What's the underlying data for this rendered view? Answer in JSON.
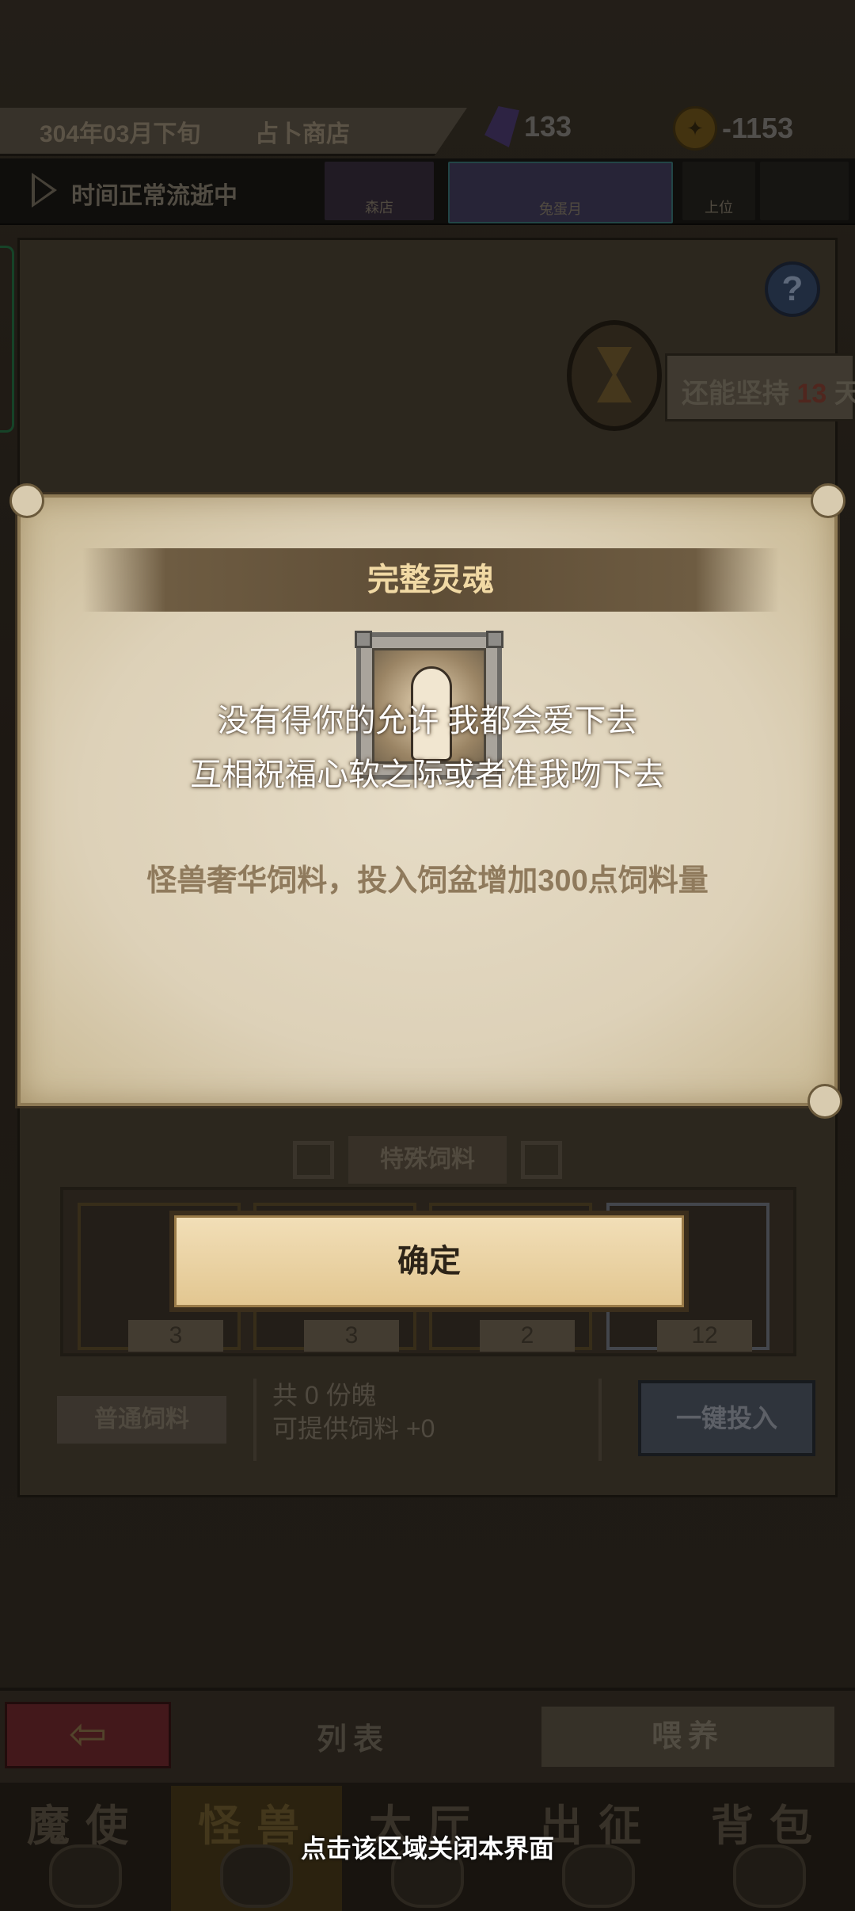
{
  "header": {
    "date": "304年03月下旬",
    "location": "占卜商店",
    "crystal_count": "133",
    "coin_count": "-1153"
  },
  "timebar": {
    "status": "时间正常流逝中",
    "banners": [
      "森店",
      "兔蛋月",
      "上位",
      ""
    ]
  },
  "persist": {
    "prefix": "还能坚持",
    "days": "13",
    "suffix": "天"
  },
  "feed_panel": {
    "special_tab": "特殊饲料",
    "slots": [
      "3",
      "3",
      "2",
      "12"
    ],
    "normal_button": "普通饲料",
    "share_line1": "共 0 份魄",
    "share_line2": "可提供饲料 +0",
    "onekey_button": "一键投入"
  },
  "bottom_bar": {
    "list_tab": "列表",
    "feed_tab": "喂养"
  },
  "nav": {
    "items": [
      "魔使",
      "怪兽",
      "大厅",
      "出征",
      "背包"
    ]
  },
  "dialog": {
    "title": "完整灵魂",
    "lyric_line1": "没有得你的允许 我都会爱下去",
    "lyric_line2": "互相祝福心软之际或者准我吻下去",
    "description": "怪兽奢华饲料，投入饲盆增加300点饲料量",
    "confirm_button": "确定"
  },
  "close_hint": "点击该区域关闭本界面",
  "colors": {
    "title_text": "#f1d9a4",
    "description_text": "#8f7a5c",
    "button_fill": "#e2c690"
  }
}
